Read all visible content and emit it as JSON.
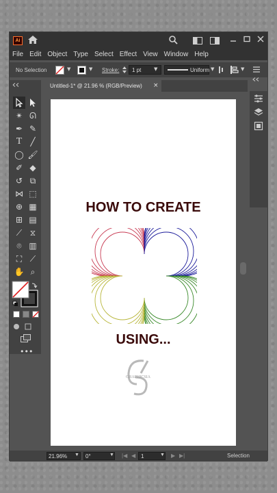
{
  "app": {
    "logo_text": "Ai"
  },
  "menu": [
    "File",
    "Edit",
    "Object",
    "Type",
    "Select",
    "Effect",
    "View",
    "Window",
    "Help"
  ],
  "control": {
    "selection_label": "No Selection",
    "stroke_label": "Stroke:",
    "stroke_value": "1 pt",
    "profile_value": "Uniform"
  },
  "document": {
    "tab_title": "Untitled-1* @ 21.96 % (RGB/Preview)",
    "close_glyph": "×"
  },
  "artboard": {
    "headline": "HOW TO CREATE",
    "subline": "USING...",
    "watermark_text": "GRAPHICSIA"
  },
  "status": {
    "zoom": "21.96%",
    "rotation": "0°",
    "artboard_number": "1",
    "tool_name": "Selection"
  },
  "colors": {
    "headline": "#3a0a0a",
    "ring_red": "#c83a52",
    "ring_blue": "#1a1a9a",
    "ring_green": "#3a8a2a",
    "ring_yellow": "#b8b63a"
  }
}
